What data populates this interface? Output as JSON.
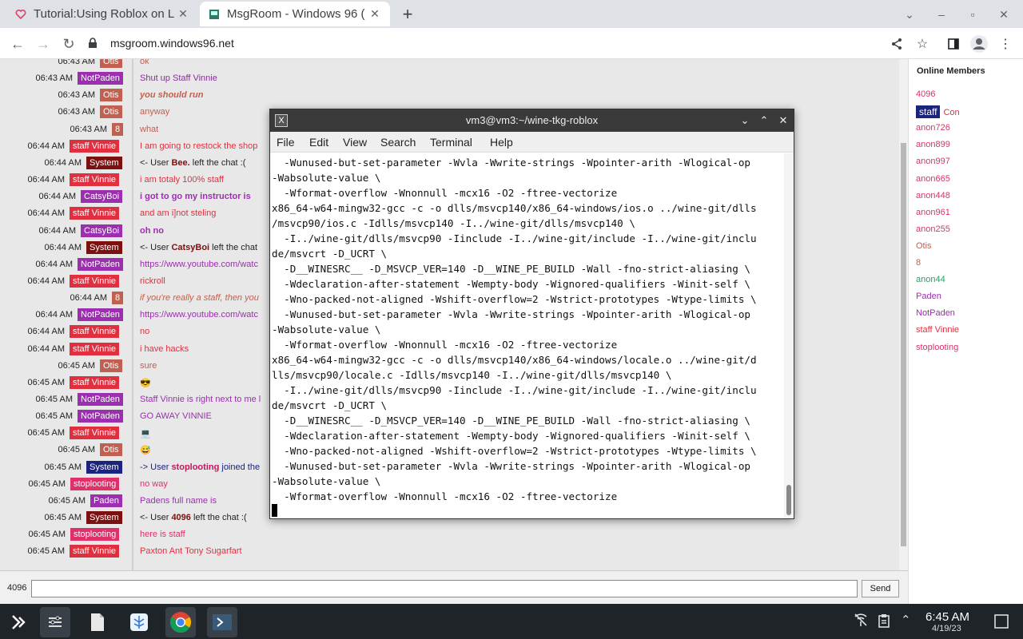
{
  "browser": {
    "tabs": [
      {
        "title": "Tutorial:Using Roblox on L",
        "active": false
      },
      {
        "title": "MsgRoom - Windows 96 (",
        "active": true
      }
    ],
    "url": "msgroom.windows96.net"
  },
  "chat": {
    "messages": [
      {
        "time": "06:43 AM",
        "nick": "Otis",
        "nick_color": "#c06050",
        "text": "ok",
        "text_color": "#c06050",
        "style": "normal"
      },
      {
        "time": "06:43 AM",
        "nick": "NotPaden",
        "nick_color": "#9b2fb0",
        "text": "Shut up Staff Vinnie",
        "text_color": "#8a2da0",
        "style": "normal"
      },
      {
        "time": "06:43 AM",
        "nick": "Otis",
        "nick_color": "#c06050",
        "text": "you should run",
        "text_color": "#c06050",
        "style": "bolditalic"
      },
      {
        "time": "06:43 AM",
        "nick": "Otis",
        "nick_color": "#c06050",
        "text": "anyway",
        "text_color": "#c06050",
        "style": "normal"
      },
      {
        "time": "06:43 AM",
        "nick": "8",
        "nick_color": "#c06050",
        "text": "what",
        "text_color": "#c06050",
        "style": "normal"
      },
      {
        "time": "06:44 AM",
        "nick": "staff Vinnie",
        "nick_color": "#e03040",
        "text": "I am going to restock the shop",
        "text_color": "#e03040",
        "style": "normal"
      },
      {
        "time": "06:44 AM",
        "nick": "System",
        "nick_color": "#7a1010",
        "text": "<- User Bee. left the chat :(",
        "text_color": "#222222",
        "style": "system",
        "highlight": "Bee."
      },
      {
        "time": "06:44 AM",
        "nick": "staff Vinnie",
        "nick_color": "#e03040",
        "text": "i am totaly 100% staff",
        "text_color": "#e03040",
        "style": "normal"
      },
      {
        "time": "06:44 AM",
        "nick": "CatsyBoi",
        "nick_color": "#9b2fb0",
        "text": "i got to go my instructor is",
        "text_color": "#9b2fb0",
        "style": "bold"
      },
      {
        "time": "06:44 AM",
        "nick": "staff Vinnie",
        "nick_color": "#e03040",
        "text": "and am i]not steling",
        "text_color": "#e03040",
        "style": "normal"
      },
      {
        "time": "06:44 AM",
        "nick": "CatsyBoi",
        "nick_color": "#9b2fb0",
        "text": "oh no",
        "text_color": "#9b2fb0",
        "style": "bold"
      },
      {
        "time": "06:44 AM",
        "nick": "System",
        "nick_color": "#7a1010",
        "text": "<- User CatsyBoi left the chat",
        "text_color": "#222222",
        "style": "system",
        "highlight": "CatsyBoi"
      },
      {
        "time": "06:44 AM",
        "nick": "NotPaden",
        "nick_color": "#9b2fb0",
        "text": "https://www.youtube.com/watc",
        "text_color": "#9b2fb0",
        "style": "normal"
      },
      {
        "time": "06:44 AM",
        "nick": "staff Vinnie",
        "nick_color": "#e03040",
        "text": "rickroll",
        "text_color": "#e03040",
        "style": "normal"
      },
      {
        "time": "06:44 AM",
        "nick": "8",
        "nick_color": "#c06050",
        "text": "if you're really a staff, then you",
        "text_color": "#c06050",
        "style": "italic"
      },
      {
        "time": "06:44 AM",
        "nick": "NotPaden",
        "nick_color": "#9b2fb0",
        "text": "https://www.youtube.com/watc",
        "text_color": "#9b2fb0",
        "style": "normal"
      },
      {
        "time": "06:44 AM",
        "nick": "staff Vinnie",
        "nick_color": "#e03040",
        "text": "no",
        "text_color": "#e03040",
        "style": "normal"
      },
      {
        "time": "06:44 AM",
        "nick": "staff Vinnie",
        "nick_color": "#e03040",
        "text": "i have  hacks",
        "text_color": "#e03040",
        "style": "normal"
      },
      {
        "time": "06:45 AM",
        "nick": "Otis",
        "nick_color": "#c06050",
        "text": "sure",
        "text_color": "#c06050",
        "style": "normal"
      },
      {
        "time": "06:45 AM",
        "nick": "staff Vinnie",
        "nick_color": "#e03040",
        "text": "😎",
        "text_color": "#e03040",
        "style": "normal"
      },
      {
        "time": "06:45 AM",
        "nick": "NotPaden",
        "nick_color": "#9b2fb0",
        "text": "Staff Vinnie is right next to me l",
        "text_color": "#9b2fb0",
        "style": "normal"
      },
      {
        "time": "06:45 AM",
        "nick": "NotPaden",
        "nick_color": "#9b2fb0",
        "text": "GO AWAY VINNIE",
        "text_color": "#9b2fb0",
        "style": "normal"
      },
      {
        "time": "06:45 AM",
        "nick": "staff Vinnie",
        "nick_color": "#e03040",
        "text": "💻",
        "text_color": "#e03040",
        "style": "normal"
      },
      {
        "time": "06:45 AM",
        "nick": "Otis",
        "nick_color": "#c06050",
        "text": "😅",
        "text_color": "#c06050",
        "style": "normal"
      },
      {
        "time": "06:45 AM",
        "nick": "System",
        "nick_color": "#1a237e",
        "text": "-> User stoplooting joined the",
        "text_color": "#1a237e",
        "style": "system",
        "highlight": "stoplooting",
        "highlight_color": "#c2185b"
      },
      {
        "time": "06:45 AM",
        "nick": "stoplooting",
        "nick_color": "#e0306a",
        "text": "no way",
        "text_color": "#e0306a",
        "style": "normal"
      },
      {
        "time": "06:45 AM",
        "nick": "Paden",
        "nick_color": "#9b2fb0",
        "text": "Padens full name is",
        "text_color": "#9b2fb0",
        "style": "normal"
      },
      {
        "time": "06:45 AM",
        "nick": "System",
        "nick_color": "#7a1010",
        "text": "<- User 4096 left the chat :(",
        "text_color": "#222222",
        "style": "system",
        "highlight": "4096"
      },
      {
        "time": "06:45 AM",
        "nick": "stoplooting",
        "nick_color": "#e0306a",
        "text": "here is  staff",
        "text_color": "#e0306a",
        "style": "normal"
      },
      {
        "time": "06:45 AM",
        "nick": "staff Vinnie",
        "nick_color": "#e03040",
        "text": "Paxton Ant Tony Sugarfart",
        "text_color": "#e03040",
        "style": "normal"
      }
    ],
    "input_nick": "4096",
    "input_value": "",
    "send_label": "Send"
  },
  "members": {
    "title": "Online Members",
    "list": [
      {
        "name": "4096",
        "color": "#e0306a"
      },
      {
        "name": "staff",
        "badge": true,
        "suffix": "Con",
        "color": "#e03040"
      },
      {
        "name": "anon726",
        "color": "#e0306a"
      },
      {
        "name": "anon899",
        "color": "#e0306a"
      },
      {
        "name": "anon997",
        "color": "#e0306a"
      },
      {
        "name": "anon665",
        "color": "#e0306a"
      },
      {
        "name": "anon448",
        "color": "#e0306a"
      },
      {
        "name": "anon961",
        "color": "#e0306a"
      },
      {
        "name": "anon255",
        "color": "#e0306a"
      },
      {
        "name": "Otis",
        "color": "#c06050"
      },
      {
        "name": "8",
        "color": "#c06050"
      },
      {
        "name": "anon44",
        "color": "#2a9a6a"
      },
      {
        "name": "Paden",
        "color": "#9b2fb0"
      },
      {
        "name": "NotPaden",
        "color": "#9b2fb0"
      },
      {
        "name": "staff Vinnie",
        "color": "#e03040"
      },
      {
        "name": "stoplooting",
        "color": "#e0306a"
      }
    ]
  },
  "terminal": {
    "title": "vm3@vm3:~/wine-tkg-roblox",
    "menu": [
      "File",
      "Edit",
      "View",
      "Search",
      "Terminal",
      "Help"
    ],
    "lines": [
      "  -Wunused-but-set-parameter -Wvla -Wwrite-strings -Wpointer-arith -Wlogical-op",
      "-Wabsolute-value \\",
      "  -Wformat-overflow -Wnonnull -mcx16 -O2 -ftree-vectorize",
      "x86_64-w64-mingw32-gcc -c -o dlls/msvcp140/x86_64-windows/ios.o ../wine-git/dlls",
      "/msvcp90/ios.c -Idlls/msvcp140 -I../wine-git/dlls/msvcp140 \\",
      "  -I../wine-git/dlls/msvcp90 -Iinclude -I../wine-git/include -I../wine-git/inclu",
      "de/msvcrt -D_UCRT \\",
      "  -D__WINESRC__ -D_MSVCP_VER=140 -D__WINE_PE_BUILD -Wall -fno-strict-aliasing \\",
      "  -Wdeclaration-after-statement -Wempty-body -Wignored-qualifiers -Winit-self \\",
      "  -Wno-packed-not-aligned -Wshift-overflow=2 -Wstrict-prototypes -Wtype-limits \\",
      "  -Wunused-but-set-parameter -Wvla -Wwrite-strings -Wpointer-arith -Wlogical-op",
      "-Wabsolute-value \\",
      "  -Wformat-overflow -Wnonnull -mcx16 -O2 -ftree-vectorize",
      "x86_64-w64-mingw32-gcc -c -o dlls/msvcp140/x86_64-windows/locale.o ../wine-git/d",
      "lls/msvcp90/locale.c -Idlls/msvcp140 -I../wine-git/dlls/msvcp140 \\",
      "  -I../wine-git/dlls/msvcp90 -Iinclude -I../wine-git/include -I../wine-git/inclu",
      "de/msvcrt -D_UCRT \\",
      "  -D__WINESRC__ -D_MSVCP_VER=140 -D__WINE_PE_BUILD -Wall -fno-strict-aliasing \\",
      "  -Wdeclaration-after-statement -Wempty-body -Wignored-qualifiers -Winit-self \\",
      "  -Wno-packed-not-aligned -Wshift-overflow=2 -Wstrict-prototypes -Wtype-limits \\",
      "  -Wunused-but-set-parameter -Wvla -Wwrite-strings -Wpointer-arith -Wlogical-op",
      "-Wabsolute-value \\",
      "  -Wformat-overflow -Wnonnull -mcx16 -O2 -ftree-vectorize"
    ]
  },
  "taskbar": {
    "time": "6:45 AM",
    "date": "4/19/23"
  }
}
